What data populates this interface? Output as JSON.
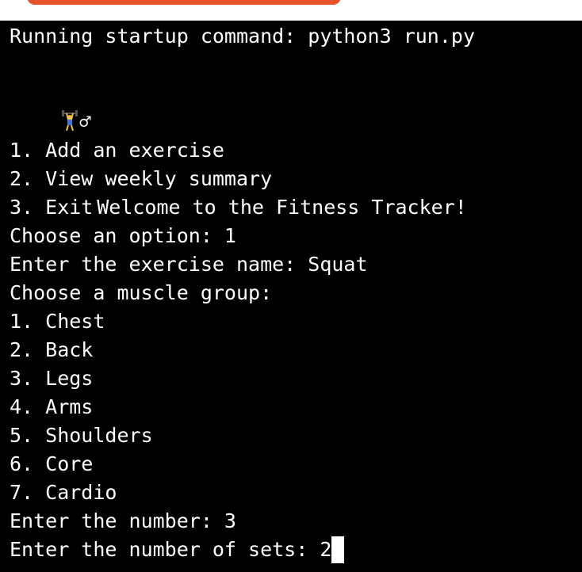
{
  "terminal": {
    "startup": "Running startup command: python3 run.py",
    "welcome": {
      "icon": "weightlifter-emoji",
      "text": "Welcome to the Fitness Tracker!"
    },
    "menu": [
      "1. Add an exercise",
      "2. View weekly summary",
      "3. Exit"
    ],
    "choose_option": "Choose an option: 1",
    "exercise_name": "Enter the exercise name: Squat",
    "muscle_prompt": "Choose a muscle group:",
    "muscle_groups": [
      "1. Chest",
      "2. Back",
      "3. Legs",
      "4. Arms",
      "5. Shoulders",
      "6. Core",
      "7. Cardio"
    ],
    "enter_number": "Enter the number: 3",
    "sets_prompt": "Enter the number of sets: 2"
  },
  "colors": {
    "background": "#000000",
    "text": "#ffffff",
    "run_button": "#e8542a"
  }
}
